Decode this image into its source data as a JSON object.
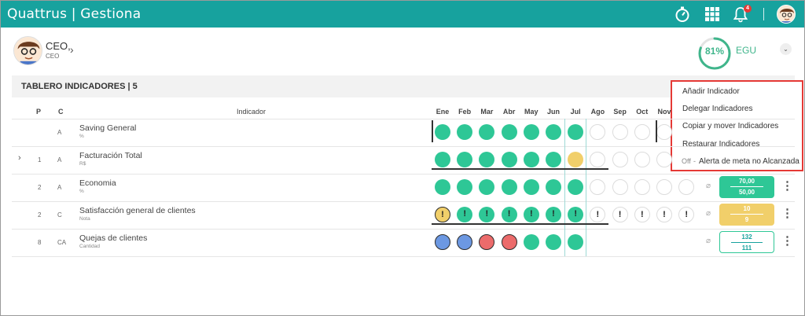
{
  "app": {
    "name": "Quattrus",
    "module": "Gestiona",
    "notification_count": "4"
  },
  "user": {
    "name": "CEO,",
    "role": "CEO",
    "performance_pct": 81,
    "performance_label": "81%",
    "unit": "EGU"
  },
  "board": {
    "title": "TABLERO INDICADORES | 5"
  },
  "columns": {
    "p": "P",
    "c": "C",
    "indicator": "Indicador",
    "months": [
      "Ene",
      "Feb",
      "Mar",
      "Abr",
      "May",
      "Jun",
      "Jul",
      "Ago",
      "Sep",
      "Oct",
      "Nov"
    ]
  },
  "rows": [
    {
      "p": "",
      "c": "A",
      "name": "Saving General",
      "unit": "%",
      "has_arrow": false,
      "months": [
        "green",
        "green",
        "green",
        "green",
        "green",
        "green",
        "green",
        "empty",
        "empty",
        "empty",
        "empty"
      ]
    },
    {
      "p": "1",
      "c": "A",
      "name": "Facturación Total",
      "unit": "R$",
      "has_arrow": true,
      "months": [
        "green",
        "green",
        "green",
        "green",
        "green",
        "green",
        "yellow",
        "empty",
        "empty",
        "empty",
        "empty"
      ]
    },
    {
      "p": "2",
      "c": "A",
      "name": "Economia",
      "unit": "%",
      "has_arrow": false,
      "months": [
        "green",
        "green",
        "green",
        "green",
        "green",
        "green",
        "green",
        "empty",
        "empty",
        "empty",
        "empty",
        "empty"
      ],
      "goal": {
        "top": "70,00",
        "bottom": "50,00",
        "style": "green"
      }
    },
    {
      "p": "2",
      "c": "C",
      "name": "Satisfacción general de clientes",
      "unit": "Nota",
      "has_arrow": false,
      "months": [
        "yellow",
        "green",
        "green",
        "green",
        "green",
        "green",
        "green",
        "empty",
        "empty",
        "empty",
        "empty",
        "empty"
      ],
      "markers": [
        "!",
        "!",
        "!",
        "!",
        "!",
        "!",
        "!",
        "!",
        "!",
        "!",
        "!",
        "!"
      ],
      "goal": {
        "top": "10",
        "bottom": "9",
        "style": "yellow"
      }
    },
    {
      "p": "8",
      "c": "CA",
      "name": "Quejas de clientes",
      "unit": "Cantidad",
      "has_arrow": false,
      "months": [
        "blue",
        "blue",
        "red",
        "red",
        "green",
        "green",
        "green"
      ],
      "goal": {
        "top": "132",
        "bottom": "111",
        "style": "outline"
      }
    }
  ],
  "menu": {
    "items": [
      "Añadir Indicador",
      "Delegar Indicadores",
      "Copiar y mover Indicadores",
      "Restaurar Indicadores"
    ],
    "toggle_state": "Off",
    "toggle_label": "Alerta de meta no Alcanzada"
  },
  "colors": {
    "header": "#17a29e",
    "green": "#2ec796",
    "yellow": "#f1cf6a",
    "blue": "#6c98e2",
    "red": "#ec6b6b",
    "menu_border": "#e53935"
  },
  "icons": {
    "timer": "stopwatch-icon",
    "apps": "grid-apps-icon",
    "bell": "bell-icon",
    "more": "kebab-icon",
    "clip": "paperclip-icon"
  }
}
